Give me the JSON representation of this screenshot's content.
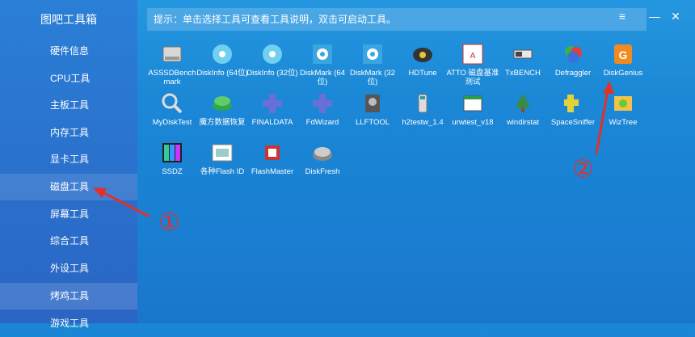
{
  "app": {
    "title": "图吧工具箱"
  },
  "hint": "提示：单击选择工具可查看工具说明，双击可启动工具。",
  "window_buttons": {
    "menu": "≡",
    "minimize": "—",
    "close": "✕"
  },
  "sidebar": {
    "items": [
      {
        "label": "硬件信息"
      },
      {
        "label": "CPU工具"
      },
      {
        "label": "主板工具"
      },
      {
        "label": "内存工具"
      },
      {
        "label": "显卡工具"
      },
      {
        "label": "磁盘工具",
        "active": true
      },
      {
        "label": "屏幕工具"
      },
      {
        "label": "综合工具"
      },
      {
        "label": "外设工具"
      },
      {
        "label": "烤鸡工具"
      },
      {
        "label": "游戏工具"
      }
    ]
  },
  "tools": [
    {
      "label": "ASSSDBenchmark",
      "icon": "drive-icon"
    },
    {
      "label": "DiskInfo (64位)",
      "icon": "disk-info-icon"
    },
    {
      "label": "DiskInfo (32位)",
      "icon": "disk-info-icon"
    },
    {
      "label": "DiskMark (64位)",
      "icon": "diskmark-icon"
    },
    {
      "label": "DiskMark (32位)",
      "icon": "diskmark-icon"
    },
    {
      "label": "HDTune",
      "icon": "hdtune-icon"
    },
    {
      "label": "ATTO 磁盘基准测试",
      "icon": "atto-icon"
    },
    {
      "label": "TxBENCH",
      "icon": "txbench-icon"
    },
    {
      "label": "Defraggler",
      "icon": "defraggler-icon"
    },
    {
      "label": "DiskGenius",
      "icon": "diskgenius-icon"
    },
    {
      "label": "MyDiskTest",
      "icon": "mydisktest-icon"
    },
    {
      "label": "魔方数据恢复",
      "icon": "recovery-icon"
    },
    {
      "label": "FINALDATA",
      "icon": "finaldata-icon"
    },
    {
      "label": "FdWizard",
      "icon": "fdwizard-icon"
    },
    {
      "label": "LLFTOOL",
      "icon": "llftool-icon"
    },
    {
      "label": "h2testw_1.4",
      "icon": "h2testw-icon"
    },
    {
      "label": "urwtest_v18",
      "icon": "urwtest-icon"
    },
    {
      "label": "windirstat",
      "icon": "windirstat-icon"
    },
    {
      "label": "SpaceSniffer",
      "icon": "spacesniffer-icon"
    },
    {
      "label": "WizTree",
      "icon": "wiztree-icon"
    },
    {
      "label": "SSDZ",
      "icon": "ssdz-icon"
    },
    {
      "label": "各种Flash ID",
      "icon": "flashid-icon"
    },
    {
      "label": "FlashMaster",
      "icon": "flashmaster-icon"
    },
    {
      "label": "DiskFresh",
      "icon": "diskfresh-icon"
    }
  ],
  "annotations": {
    "one": "①",
    "two": "②"
  },
  "colors": {
    "annotation": "#e0312a",
    "sidebar": "#2a6fcb"
  }
}
